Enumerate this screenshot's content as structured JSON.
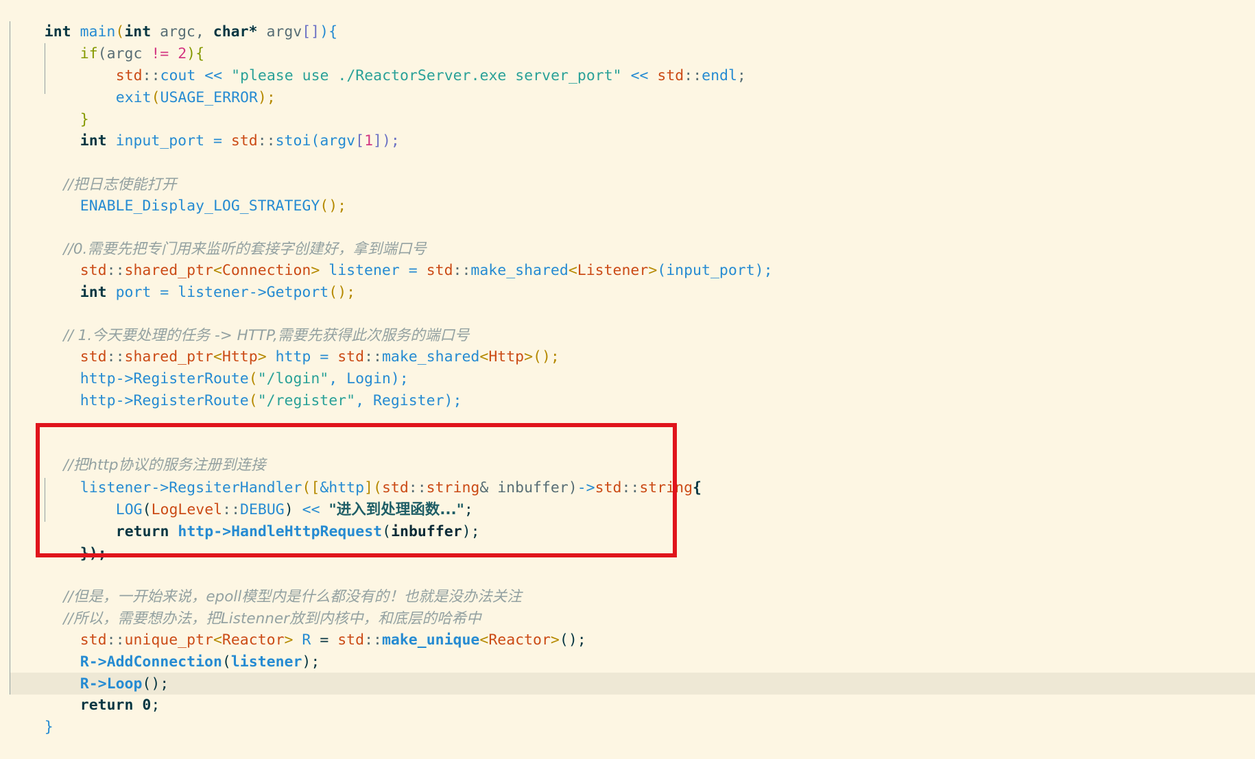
{
  "editor": {
    "language": "cpp",
    "theme": "solarized-light",
    "background": "#FDF6E3",
    "current_line_background": "#EEE8D5",
    "highlight_box_color": "#E0141C"
  },
  "code": {
    "l1": [
      "int",
      " ",
      "main",
      "(",
      "int",
      " argc, ",
      "char*",
      " argv",
      "[]",
      "){"
    ],
    "l2": [
      "if",
      "(argc ",
      "!=",
      " ",
      "2",
      "){"
    ],
    "l3": [
      "std",
      "::",
      "cout",
      " << ",
      "\"please use ./ReactorServer.exe server_port\"",
      " << ",
      "std",
      "::",
      "endl",
      ";"
    ],
    "l4": [
      "exit",
      "(",
      "USAGE_ERROR",
      ");"
    ],
    "l5": [
      "}"
    ],
    "l6": [
      "int",
      " input_port ",
      "=",
      " ",
      "std",
      "::",
      "stoi",
      "(argv",
      "[",
      "1",
      "]);"
    ],
    "l7": [
      ""
    ],
    "l8": [
      "//把日志使能打开"
    ],
    "l9": [
      "ENABLE_Display_LOG_STRATEGY",
      "();"
    ],
    "l10": [
      ""
    ],
    "l11": [
      "//0.需要先把专门用来监听的套接字创建好，拿到端口号"
    ],
    "l12": [
      "std",
      "::",
      "shared_ptr",
      "<",
      "Connection",
      ">",
      " listener ",
      "=",
      " ",
      "std",
      "::",
      "make_shared",
      "<",
      "Listener",
      ">",
      "(input_port);"
    ],
    "l13": [
      "int",
      " port ",
      "=",
      " listener",
      "->",
      "Getport",
      "();"
    ],
    "l14": [
      ""
    ],
    "l15": [
      "// 1.今天要处理的任务 -> HTTP,需要先获得此次服务的端口号"
    ],
    "l16": [
      "std",
      "::",
      "shared_ptr",
      "<",
      "Http",
      ">",
      " http ",
      "=",
      " ",
      "std",
      "::",
      "make_shared",
      "<",
      "Http",
      ">",
      "();"
    ],
    "l17": [
      "http",
      "->",
      "RegisterRoute",
      "(",
      "\"/login\"",
      ", Login);"
    ],
    "l18": [
      "http",
      "->",
      "RegisterRoute",
      "(",
      "\"/register\"",
      ", Register);"
    ],
    "l19": [
      ""
    ],
    "l20": [
      "//把http协议的服务注册到连接"
    ],
    "l21": [
      "listener",
      "->",
      "RegsiterHandler",
      "(",
      "[",
      "&http",
      "](",
      "std",
      "::",
      "string",
      "& inbuffer)",
      "->",
      "std",
      "::",
      "string",
      "{"
    ],
    "l22": [
      "LOG",
      "(",
      "LogLevel",
      "::",
      "DEBUG",
      ")",
      " << ",
      "\"进入到处理函数...\"",
      ";"
    ],
    "l23": [
      "return",
      " ",
      "http",
      "->",
      "HandleHttpRequest",
      "(",
      "inbuffer",
      ");"
    ],
    "l24": [
      "});"
    ],
    "l25": [
      "//但是，一开始来说，epoll模型内是什么都没有的！也就是没办法关注"
    ],
    "l26": [
      "//所以，需要想办法，把Listenner放到内核中，和底层的哈希中"
    ],
    "l27": [
      "std",
      "::",
      "unique_ptr",
      "<",
      "Reactor",
      ">",
      " R ",
      "=",
      " ",
      "std",
      "::",
      "make_unique",
      "<",
      "Reactor",
      ">",
      "();"
    ],
    "l28": [
      "R",
      "->",
      "AddConnection",
      "(",
      "listener",
      ");"
    ],
    "l29": [
      "R",
      "->",
      "Loop",
      "();"
    ],
    "l30": [
      "return",
      " ",
      "0",
      ";"
    ],
    "l31": [
      "}"
    ]
  }
}
